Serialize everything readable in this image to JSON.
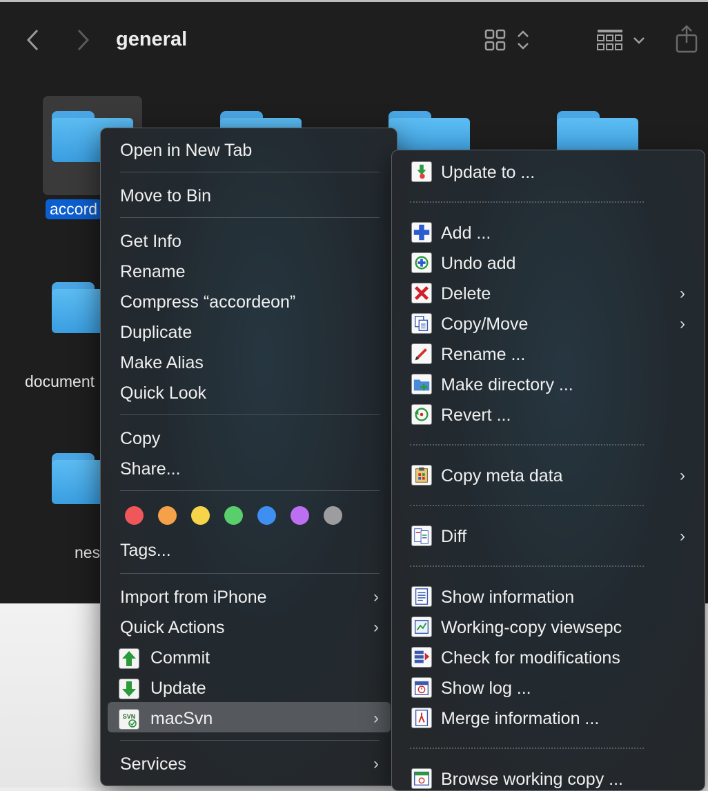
{
  "window": {
    "title": "general"
  },
  "toolbar": {
    "back_icon": "chevron-left-icon",
    "forward_icon": "chevron-right-icon",
    "view_icon": "grid-view-icon",
    "group_icon": "group-by-icon",
    "share_icon": "share-icon"
  },
  "files": [
    {
      "label": "accord",
      "selected": true
    },
    {
      "label": "document",
      "selected": false
    },
    {
      "label": "nes",
      "selected": false
    }
  ],
  "context_menu": {
    "items": {
      "open_new_tab": "Open in New Tab",
      "move_to_bin": "Move to Bin",
      "get_info": "Get Info",
      "rename": "Rename",
      "compress": "Compress “accordeon”",
      "duplicate": "Duplicate",
      "make_alias": "Make Alias",
      "quick_look": "Quick Look",
      "copy": "Copy",
      "share": "Share...",
      "tags": "Tags...",
      "import_iphone": "Import from iPhone",
      "quick_actions": "Quick Actions",
      "commit": "Commit",
      "update": "Update",
      "macsvn": "macSvn",
      "services": "Services"
    },
    "tag_colors": [
      "#f0575a",
      "#f5a14a",
      "#f6d54a",
      "#58cf6a",
      "#3f8ef2",
      "#bc6ff0",
      "#9d9d9f"
    ],
    "chevron": "›"
  },
  "submenu": {
    "items": {
      "update_to": "Update to ...",
      "add": "Add ...",
      "undo_add": "Undo add",
      "delete": "Delete",
      "copy_move": "Copy/Move",
      "rename": "Rename ...",
      "make_directory": "Make directory ...",
      "revert": "Revert ...",
      "copy_meta": "Copy meta data",
      "diff": "Diff",
      "show_information": "Show information",
      "working_copy": "Working-copy viewsepc",
      "check_modifications": "Check for modifications",
      "show_log": "Show log ...",
      "merge_information": "Merge information ...",
      "browse_working_copy": "Browse working copy ..."
    }
  }
}
